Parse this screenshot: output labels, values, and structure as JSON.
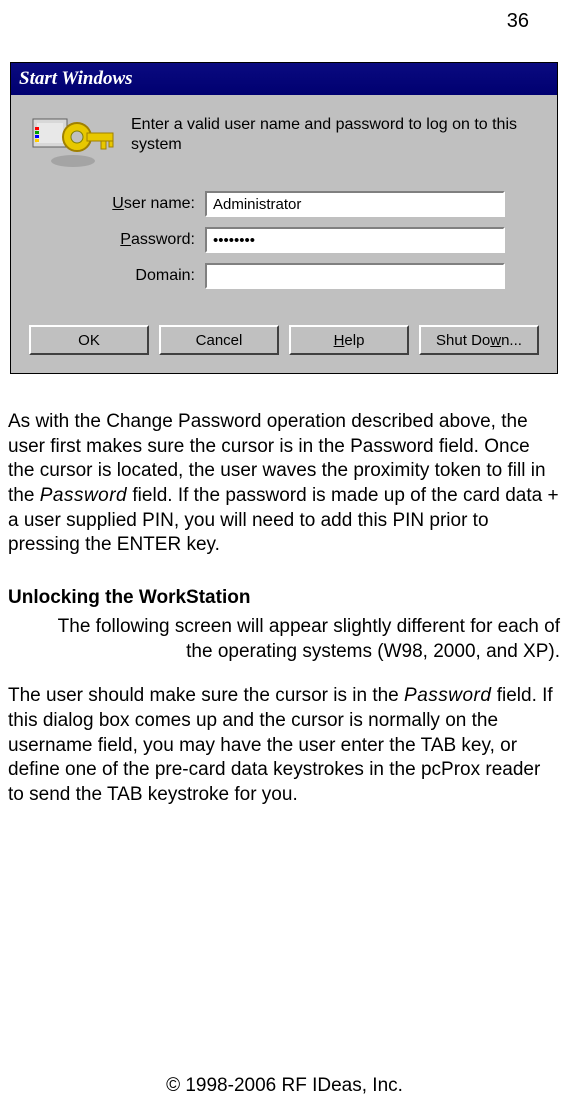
{
  "page_number": "36",
  "dialog": {
    "title": "Start Windows",
    "intro_text": "Enter a valid user name and password to log on to this system",
    "fields": {
      "username_label_pre": "U",
      "username_label_rest": "ser name:",
      "username_value": "Administrator",
      "password_label_pre": "P",
      "password_label_rest": "assword:",
      "password_value": "••••••••",
      "domain_label": "Domain:",
      "domain_value": ""
    },
    "buttons": {
      "ok": "OK",
      "cancel": "Cancel",
      "help_pre": "H",
      "help_rest": "elp",
      "shutdown_pre": "Shut Do",
      "shutdown_ul": "w",
      "shutdown_rest": "n..."
    }
  },
  "body": {
    "para1_a": "As with the Change Password operation described above, the user first makes sure the cursor is in the Password field. Once the cursor is located, the user waves the proximity token to fill in the ",
    "para1_italic": "Password",
    "para1_b": " field. If the password is made up of the card data + a user supplied PIN, you will need to add this PIN prior to pressing the ENTER key.",
    "heading": "Unlocking the WorkStation",
    "para2": "The following screen will appear slightly different for each of the operating systems (W98, 2000, and XP).",
    "para3_a": "The user should make sure the cursor is in the ",
    "para3_italic": "Password",
    "para3_b": " field. If this dialog box comes up and the cursor is normally on the username field, you may have the user enter the TAB key, or define one of the pre-card data keystrokes in the pcProx reader to send the TAB keystroke for you."
  },
  "copyright": "© 1998-2006 RF IDeas, Inc."
}
